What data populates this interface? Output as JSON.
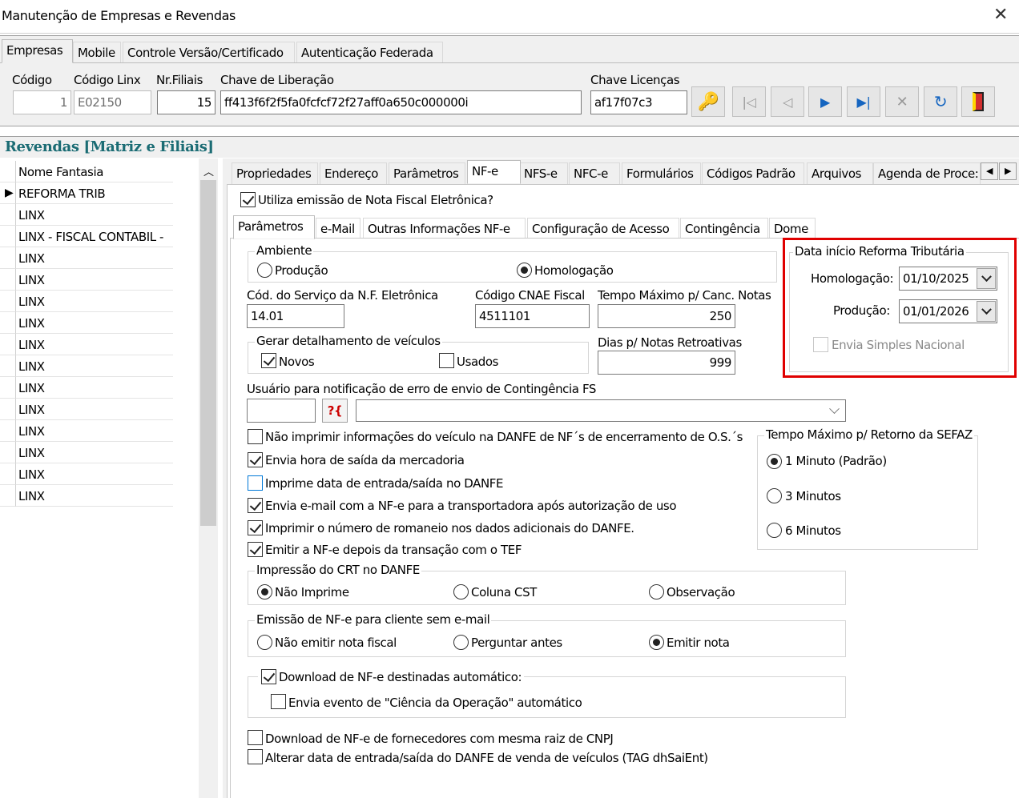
{
  "window": {
    "title": "Manutenção de Empresas e Revendas"
  },
  "top_tabs": [
    "Empresas",
    "Mobile",
    "Controle Versão/Certificado",
    "Autenticação Federada"
  ],
  "empresa": {
    "labels": {
      "codigo": "Código",
      "codigo_linx": "Código Linx",
      "nr_filiais": "Nr.Filiais",
      "chave_liberacao": "Chave de Liberação",
      "chave_licencas": "Chave Licenças"
    },
    "codigo": "1",
    "codigo_linx": "E02150",
    "nr_filiais": "15",
    "chave_liberacao": "ff413f6f2f5fa0fcfcf72f27aff0a650c000000i",
    "chave_licencas": "af17f07c3"
  },
  "nav_icons": [
    "key-icon",
    "first-icon",
    "prior-icon",
    "next-icon",
    "last-icon",
    "delete-icon",
    "refresh-icon",
    "exit-icon"
  ],
  "revendas": {
    "title": "Revendas [Matriz e Filiais]",
    "column": "Nome Fantasia",
    "rows": [
      "REFORMA TRIB",
      "LINX",
      "LINX - FISCAL CONTABIL -",
      "LINX",
      "LINX",
      "LINX",
      "LINX",
      "LINX",
      "LINX",
      "LINX",
      "LINX",
      "LINX",
      "LINX",
      "LINX",
      "LINX"
    ]
  },
  "detail_tabs": [
    "Propriedades",
    "Endereço",
    "Parâmetros",
    "NF-e",
    "NFS-e",
    "NFC-e",
    "Formulários",
    "Códigos Padrão",
    "Arquivos",
    "Agenda de Proce:"
  ],
  "nfe": {
    "utiliza": "Utiliza emissão de Nota Fiscal Eletrônica?",
    "sub_tabs": [
      "Parâmetros",
      "e-Mail",
      "Outras Informações NF-e",
      "Configuração de Acesso",
      "Contingência",
      "Dome"
    ],
    "ambiente": {
      "legend": "Ambiente",
      "producao": "Produção",
      "homologacao": "Homologação"
    },
    "cod_servico": {
      "label": "Cód. do Serviço da N.F. Eletrônica",
      "value": "14.01"
    },
    "cnae": {
      "label": "Código CNAE Fiscal",
      "value": "4511101"
    },
    "tempo_canc": {
      "label": "Tempo Máximo p/ Canc. Notas",
      "value": "250"
    },
    "veiculos": {
      "legend": "Gerar detalhamento de veículos",
      "novos": "Novos",
      "usados": "Usados"
    },
    "dias_retro": {
      "label": "Dias p/ Notas Retroativas",
      "value": "999"
    },
    "usuario_label": "Usuário para notificação de erro de envio de Contingência FS",
    "search_btn": "?{",
    "checks": [
      "Não imprimir informações do veículo na DANFE de NF´s de encerramento de O.S.´s",
      "Envia hora de saída da mercadoria",
      "Imprime data de entrada/saída no DANFE",
      "Envia e-mail com a NF-e para a transportadora após autorização de uso",
      "Imprimir o número de romaneio nos dados adicionais do DANFE.",
      "Emitir a NF-e depois da transação com o TEF"
    ],
    "sefaz": {
      "legend": "Tempo Máximo p/ Retorno da SEFAZ",
      "opt1": "1 Minuto (Padrão)",
      "opt2": "3 Minutos",
      "opt3": "6 Minutos"
    },
    "crt": {
      "legend": "Impressão do CRT no DANFE",
      "opt1": "Não Imprime",
      "opt2": "Coluna CST",
      "opt3": "Observação"
    },
    "sem_email": {
      "legend": "Emissão de NF-e para cliente sem e-mail",
      "opt1": "Não emitir nota fiscal",
      "opt2": "Perguntar antes",
      "opt3": "Emitir nota"
    },
    "download": {
      "legend": "Download de NF-e destinadas automático:",
      "ciencia": "Envia evento de \"Ciência da Operação\" automático"
    },
    "download_fornec": "Download de NF-e de fornecedores com mesma raiz de CNPJ",
    "alterar_data": "Alterar data de entrada/saída do DANFE de venda de veículos (TAG dhSaiEnt)"
  },
  "reforma": {
    "legend": "Data início Reforma Tributária",
    "homologacao_label": "Homologação:",
    "homologacao": "01/10/2025",
    "producao_label": "Produção:",
    "producao": "01/01/2026",
    "simples": "Envia Simples Nacional",
    "highlight_color": "#e00000"
  }
}
